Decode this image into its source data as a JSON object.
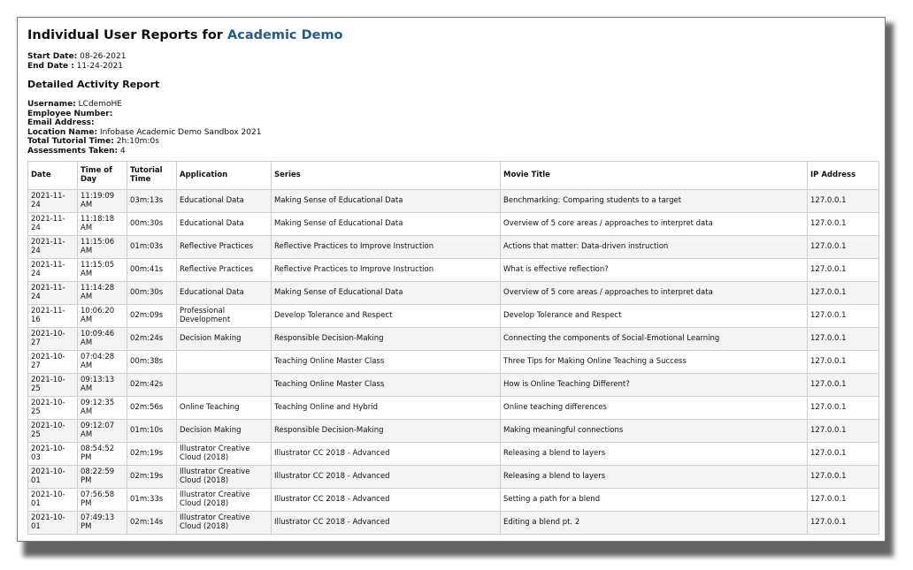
{
  "header": {
    "title_prefix": "Individual User Reports for",
    "title_org": "Academic Demo"
  },
  "dates": {
    "start_label": "Start Date:",
    "start_value": "08-26-2021",
    "end_label": "End Date :",
    "end_value": "11-24-2021"
  },
  "section_title": "Detailed Activity Report",
  "user_info": {
    "username_label": "Username:",
    "username_value": "LCdemoHE",
    "employee_label": "Employee Number:",
    "employee_value": "",
    "email_label": "Email Address:",
    "email_value": "",
    "location_label": "Location Name:",
    "location_value": "Infobase Academic Demo Sandbox 2021",
    "tutorial_label": "Total Tutorial Time:",
    "tutorial_value": "2h:10m:0s",
    "assessments_label": "Assessments Taken:",
    "assessments_value": "4"
  },
  "table": {
    "headers": [
      "Date",
      "Time of Day",
      "Tutorial Time",
      "Application",
      "Series",
      "Movie Title",
      "IP Address"
    ],
    "rows": [
      [
        "2021-11-24",
        "11:19:09 AM",
        "03m:13s",
        "Educational Data",
        "Making Sense of Educational Data",
        "Benchmarking: Comparing students to a target",
        "127.0.0.1"
      ],
      [
        "2021-11-24",
        "11:18:18 AM",
        "00m:30s",
        "Educational Data",
        "Making Sense of Educational Data",
        "Overview of 5 core areas / approaches to interpret data",
        "127.0.0.1"
      ],
      [
        "2021-11-24",
        "11:15:06 AM",
        "01m:03s",
        "Reflective Practices",
        "Reflective Practices to Improve Instruction",
        "Actions that matter: Data-driven instruction",
        "127.0.0.1"
      ],
      [
        "2021-11-24",
        "11:15:05 AM",
        "00m:41s",
        "Reflective Practices",
        "Reflective Practices to Improve Instruction",
        "What is effective reflection?",
        "127.0.0.1"
      ],
      [
        "2021-11-24",
        "11:14:28 AM",
        "00m:30s",
        "Educational Data",
        "Making Sense of Educational Data",
        "Overview of 5 core areas / approaches to interpret data",
        "127.0.0.1"
      ],
      [
        "2021-11-16",
        "10:06:20 AM",
        "02m:09s",
        "Professional Development",
        "Develop Tolerance and Respect",
        "Develop Tolerance and Respect",
        "127.0.0.1"
      ],
      [
        "2021-10-27",
        "10:09:46 AM",
        "02m:24s",
        "Decision Making",
        "Responsible Decision-Making",
        "Connecting the components of Social-Emotional Learning",
        "127.0.0.1"
      ],
      [
        "2021-10-27",
        "07:04:28 AM",
        "00m:38s",
        "",
        "Teaching Online Master Class",
        "Three Tips for Making Online Teaching a Success",
        "127.0.0.1"
      ],
      [
        "2021-10-25",
        "09:13:13 AM",
        "02m:42s",
        "",
        "Teaching Online Master Class",
        "How is Online Teaching Different?",
        "127.0.0.1"
      ],
      [
        "2021-10-25",
        "09:12:35 AM",
        "02m:56s",
        "Online Teaching",
        "Teaching Online and Hybrid",
        "Online teaching differences",
        "127.0.0.1"
      ],
      [
        "2021-10-25",
        "09:12:07 AM",
        "01m:10s",
        "Decision Making",
        "Responsible Decision-Making",
        "Making meaningful connections",
        "127.0.0.1"
      ],
      [
        "2021-10-03",
        "08:54:52 PM",
        "02m:19s",
        "Illustrator Creative Cloud (2018)",
        "Illustrator CC 2018 - Advanced",
        "Releasing a blend to layers",
        "127.0.0.1"
      ],
      [
        "2021-10-01",
        "08:22:59 PM",
        "02m:19s",
        "Illustrator Creative Cloud (2018)",
        "Illustrator CC 2018 - Advanced",
        "Releasing a blend to layers",
        "127.0.0.1"
      ],
      [
        "2021-10-01",
        "07:56:58 PM",
        "01m:33s",
        "Illustrator Creative Cloud (2018)",
        "Illustrator CC 2018 - Advanced",
        "Setting a path for a blend",
        "127.0.0.1"
      ],
      [
        "2021-10-01",
        "07:49:13 PM",
        "02m:14s",
        "Illustrator Creative Cloud (2018)",
        "Illustrator CC 2018 - Advanced",
        "Editing a blend pt. 2",
        "127.0.0.1"
      ]
    ]
  }
}
